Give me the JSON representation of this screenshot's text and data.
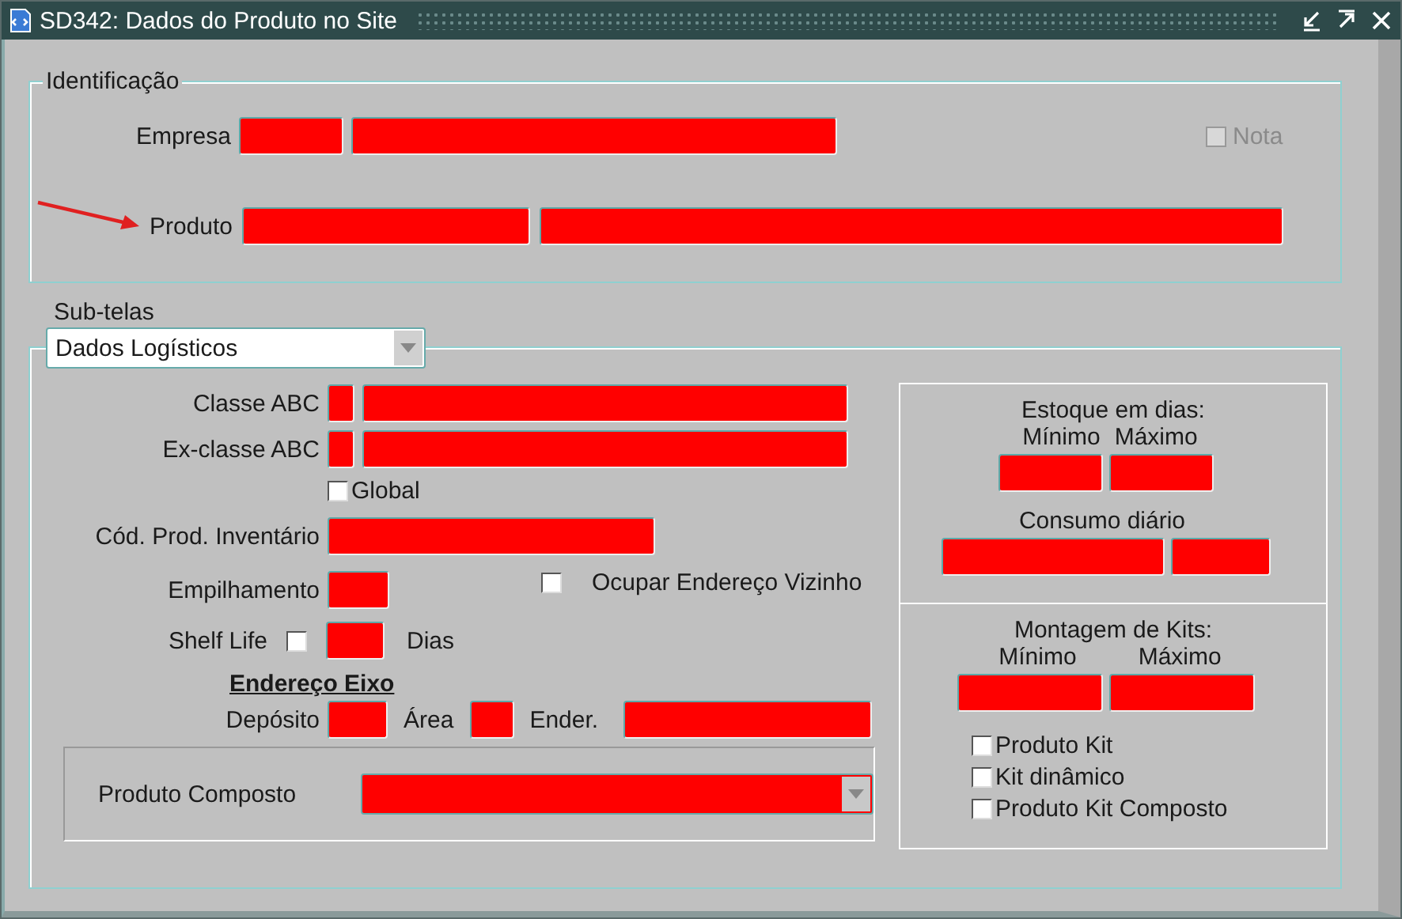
{
  "window": {
    "title": "SD342: Dados do Produto no Site"
  },
  "identificacao": {
    "legend": "Identificação",
    "empresa": {
      "label": "Empresa",
      "fields": [
        {
          "highlighted": true
        },
        {
          "highlighted": true
        }
      ]
    },
    "nota": {
      "label": "Nota",
      "checked": false,
      "disabled": true
    },
    "produto": {
      "label": "Produto",
      "fields": [
        {
          "highlighted": true
        },
        {
          "highlighted": true
        }
      ]
    }
  },
  "subtelas": {
    "label": "Sub-telas",
    "value": "Dados Logísticos"
  },
  "logistica": {
    "classe_abc": {
      "label": "Classe ABC",
      "fields": [
        {
          "highlighted": true
        },
        {
          "highlighted": true
        }
      ]
    },
    "ex_classe_abc": {
      "label": "Ex-classe ABC",
      "fields": [
        {
          "highlighted": true
        },
        {
          "highlighted": true
        }
      ]
    },
    "global": {
      "label": "Global",
      "checked": false
    },
    "cod_prod_inventario": {
      "label": "Cód. Prod. Inventário",
      "highlighted": true
    },
    "empilhamento": {
      "label": "Empilhamento",
      "highlighted": true
    },
    "ocupar_endereco_vizinho": {
      "label": "Ocupar Endereço Vizinho",
      "checked": false
    },
    "shelf_life": {
      "label": "Shelf Life",
      "checked": false,
      "highlighted": true,
      "unit": "Dias"
    },
    "endereco_eixo": {
      "heading": "Endereço Eixo",
      "deposito": {
        "label": "Depósito",
        "highlighted": true
      },
      "area": {
        "label": "Área",
        "highlighted": true
      },
      "ender": {
        "label": "Ender.",
        "highlighted": true
      }
    },
    "produto_composto": {
      "label": "Produto Composto",
      "highlighted": true
    }
  },
  "estoque_em_dias": {
    "heading": "Estoque em dias:",
    "min_label": "Mínimo",
    "max_label": "Máximo",
    "fields": [
      {
        "highlighted": true
      },
      {
        "highlighted": true
      }
    ],
    "consumo_label": "Consumo diário",
    "consumo_fields": [
      {
        "highlighted": true
      },
      {
        "highlighted": true
      }
    ]
  },
  "montagem_de_kits": {
    "heading": "Montagem de Kits:",
    "min_label": "Mínimo",
    "max_label": "Máximo",
    "fields": [
      {
        "highlighted": true
      },
      {
        "highlighted": true
      }
    ],
    "options": [
      {
        "label": "Produto Kit",
        "checked": false
      },
      {
        "label": "Kit dinâmico",
        "checked": false
      },
      {
        "label": "Produto Kit Composto",
        "checked": false
      }
    ]
  }
}
